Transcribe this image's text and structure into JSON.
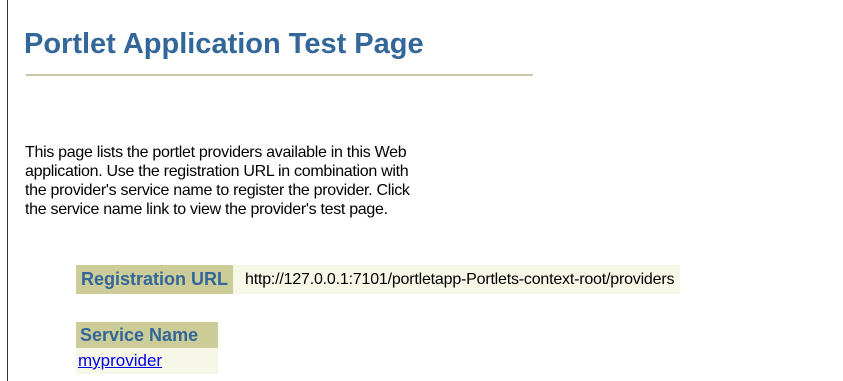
{
  "page": {
    "title": "Portlet Application Test Page",
    "intro_lines": [
      "This page lists the portlet providers available in this Web",
      "application. Use the registration URL in combination with",
      "the provider's service name to register the provider. Click",
      "the service name link to view the provider's test page."
    ]
  },
  "registration": {
    "label": "Registration URL",
    "url": "http://127.0.0.1:7101/portletapp-Portlets-context-root/providers"
  },
  "services": {
    "header": "Service Name",
    "rows": [
      {
        "name": "myprovider"
      }
    ]
  },
  "colors": {
    "title": "#336699",
    "label_bg": "#cccc99",
    "cell_bg": "#f7f7e7",
    "link": "#0000ee"
  }
}
